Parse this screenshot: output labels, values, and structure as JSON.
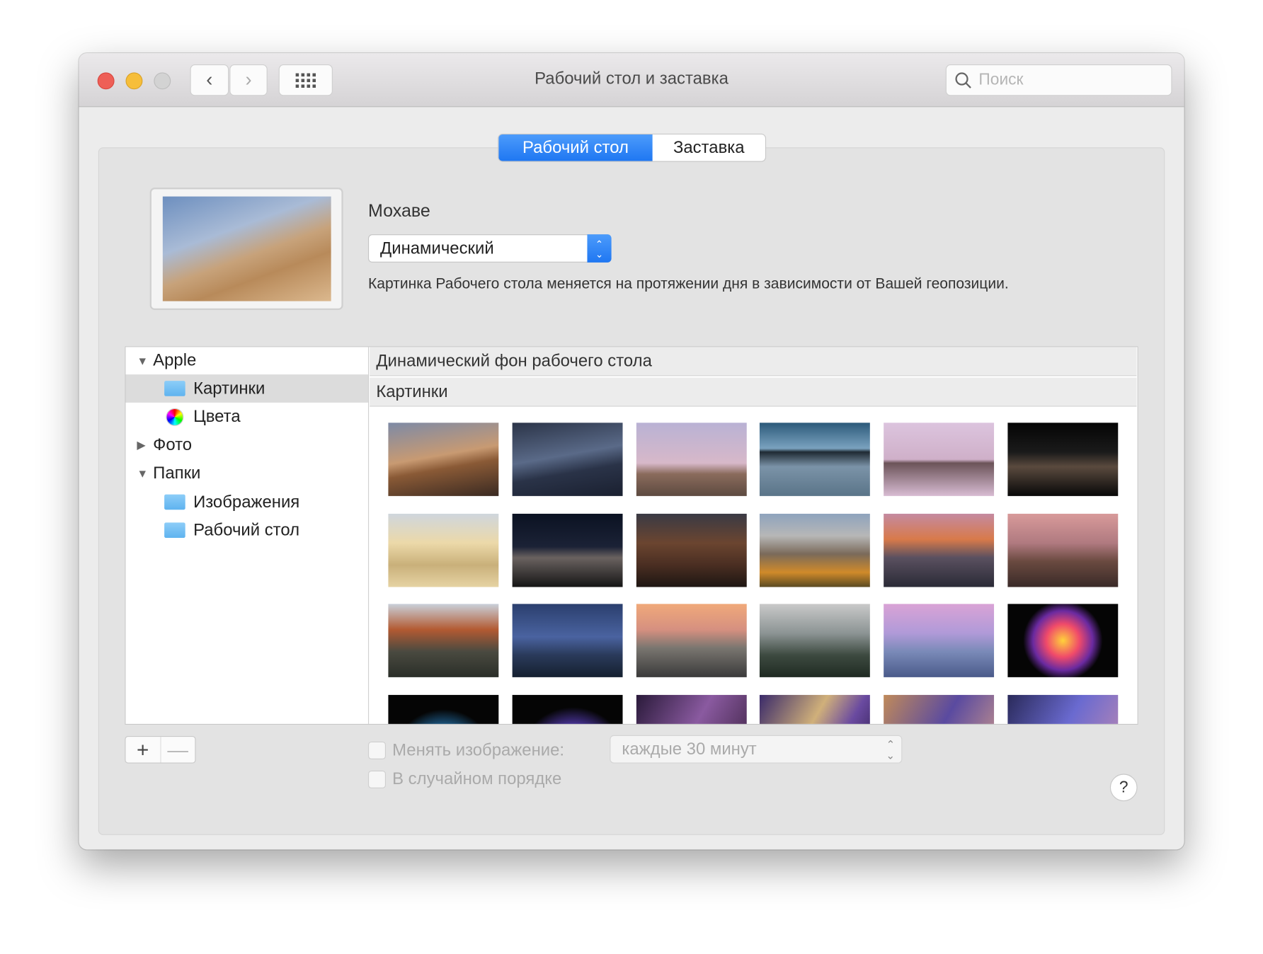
{
  "window": {
    "title": "Рабочий стол и заставка"
  },
  "toolbar": {
    "back_icon": "‹",
    "forward_icon": "›",
    "grid_icon": "show-all",
    "search_placeholder": "Поиск"
  },
  "tabs": [
    {
      "label": "Рабочий стол",
      "selected": true
    },
    {
      "label": "Заставка",
      "selected": false
    }
  ],
  "current": {
    "name": "Мохаве",
    "mode": "Динамический",
    "description": "Картинка Рабочего стола меняется на протяжении дня в зависимости от Вашей геопозиции."
  },
  "sidebar": {
    "items": [
      {
        "label": "Apple",
        "expanded": true
      },
      {
        "label": "Картинки",
        "selected": true
      },
      {
        "label": "Цвета"
      },
      {
        "label": "Фото",
        "expanded": false
      },
      {
        "label": "Папки",
        "expanded": true
      },
      {
        "label": "Изображения"
      },
      {
        "label": "Рабочий стол"
      }
    ]
  },
  "gallery": {
    "section1": "Динамический фон рабочего стола",
    "section2": "Картинки"
  },
  "bottom": {
    "add": "+",
    "remove": "—",
    "change_label": "Менять изображение:",
    "change_checked": false,
    "interval": "каждые 30 минут",
    "random_label": "В случайном порядке",
    "random_checked": false,
    "help": "?"
  },
  "colors": {
    "accent": "#1f77f2",
    "close": "#ee5f57",
    "minimize": "#f6be3a"
  }
}
